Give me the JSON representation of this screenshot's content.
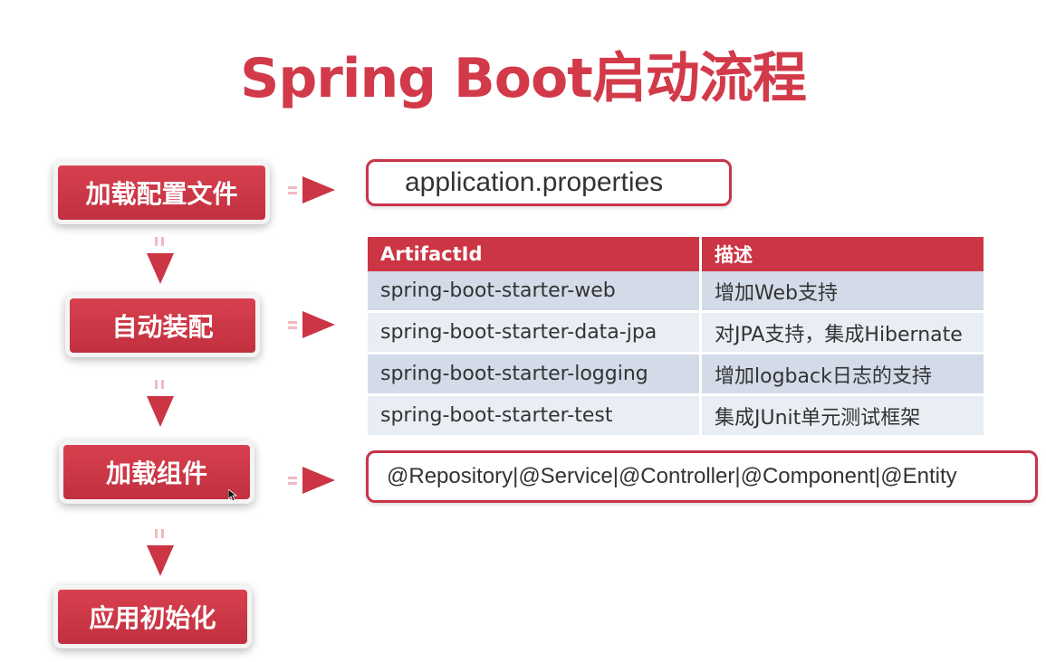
{
  "title": "Spring Boot启动流程",
  "steps": [
    {
      "label": "加载配置文件"
    },
    {
      "label": "自动装配"
    },
    {
      "label": "加载组件"
    },
    {
      "label": "应用初始化"
    }
  ],
  "config_box": {
    "text": "application.properties"
  },
  "table": {
    "headers": [
      "ArtifactId",
      "描述"
    ],
    "rows": [
      [
        "spring-boot-starter-web",
        "增加Web支持"
      ],
      [
        "spring-boot-starter-data-jpa",
        "对JPA支持，集成Hibernate"
      ],
      [
        "spring-boot-starter-logging",
        "增加logback日志的支持"
      ],
      [
        "spring-boot-starter-test",
        "集成JUnit单元测试框架"
      ]
    ]
  },
  "components_box": {
    "text": "@Repository|@Service|@Controller|@Component|@Entity"
  },
  "colors": {
    "accent": "#cc3544",
    "table_row_dark": "#d3dbe9",
    "table_row_light": "#e9eef5"
  }
}
